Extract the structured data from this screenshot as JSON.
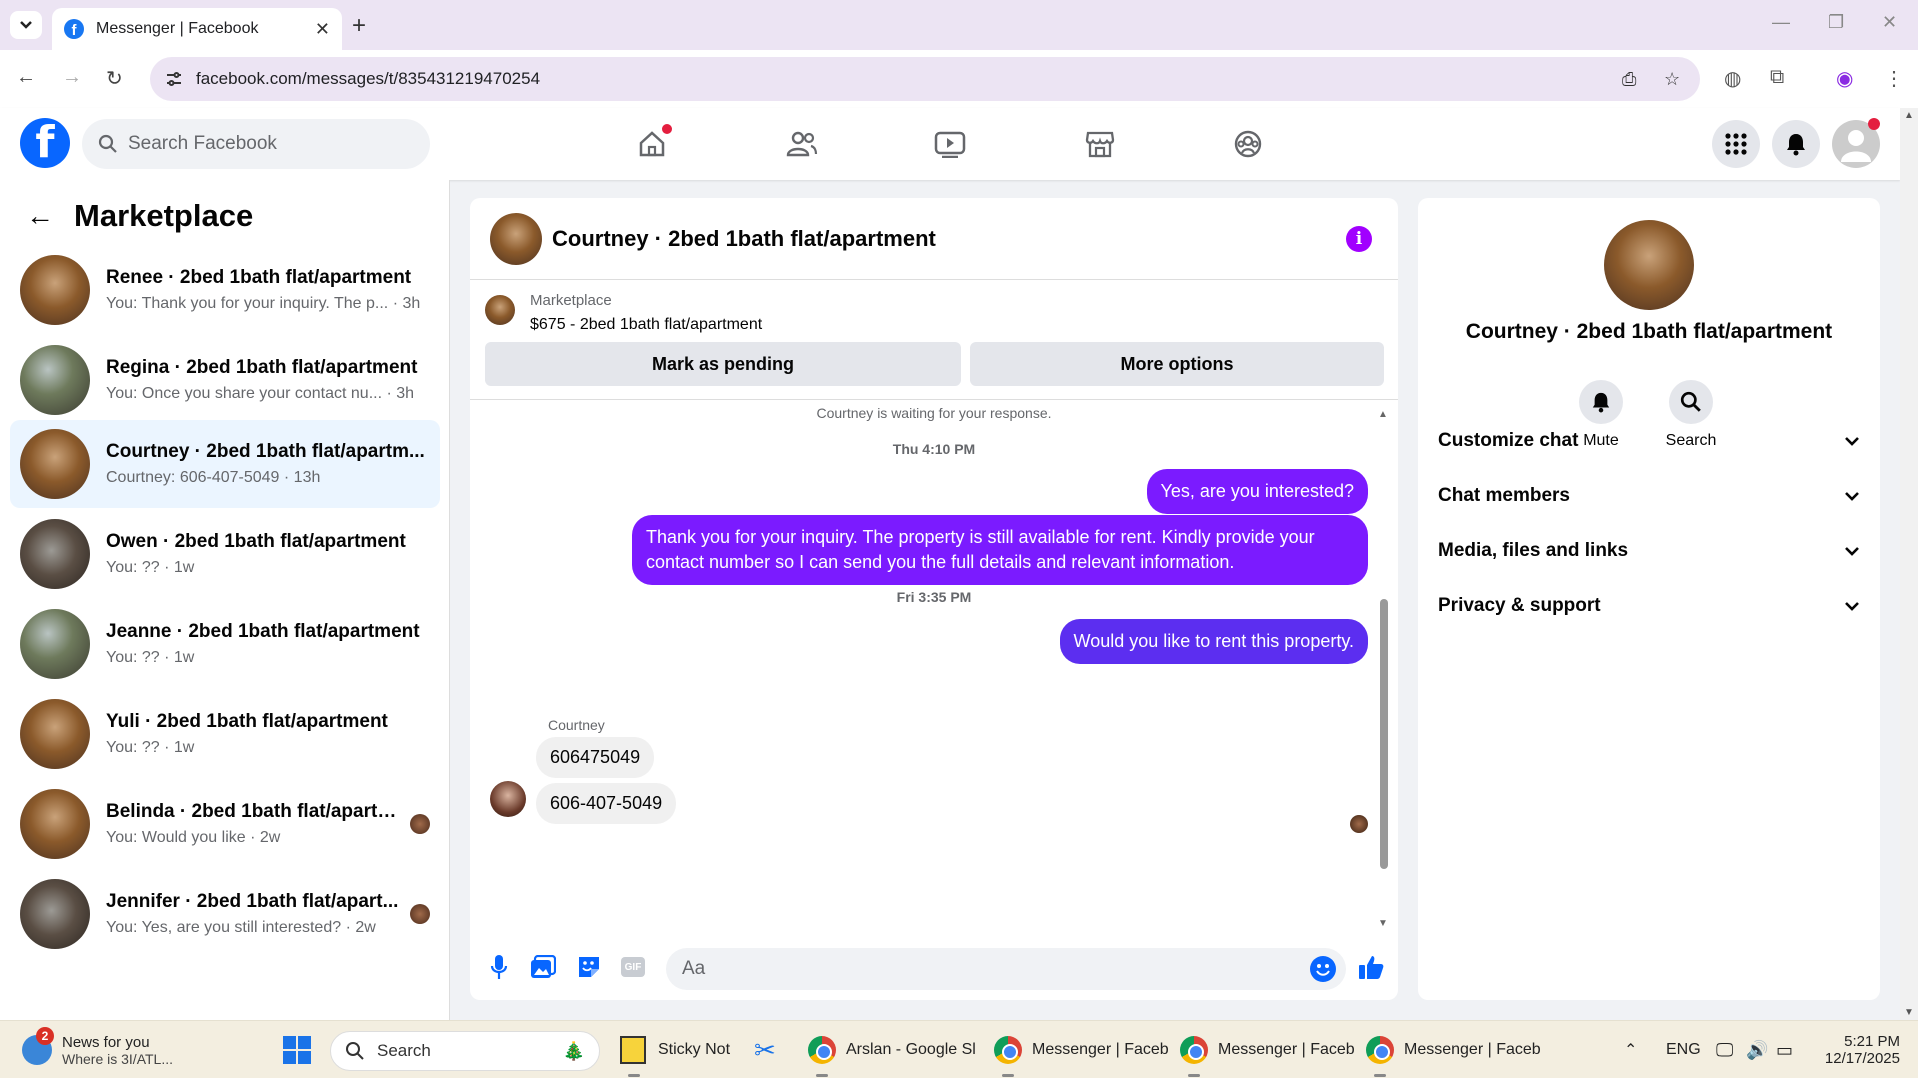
{
  "browser": {
    "tab_title": "Messenger | Facebook",
    "url": "facebook.com/messages/t/835431219470254"
  },
  "fb": {
    "search_placeholder": "Search Facebook"
  },
  "sidebar": {
    "title": "Marketplace",
    "conversations": [
      {
        "name": "Renee · 2bed 1bath flat/apartment",
        "preview": "You: Thank you for your inquiry. The p... · 3h",
        "avatar": "kitchen"
      },
      {
        "name": "Regina · 2bed 1bath flat/apartment",
        "preview": "You: Once you share your contact nu... · 3h",
        "avatar": "green"
      },
      {
        "name": "Courtney · 2bed 1bath flat/apartm...",
        "preview": "Courtney: 606-407-5049 · 13h",
        "avatar": "kitchen",
        "active": true
      },
      {
        "name": "Owen · 2bed 1bath flat/apartment",
        "preview": "You: ?? · 1w",
        "avatar": "dark"
      },
      {
        "name": "Jeanne · 2bed 1bath flat/apartment",
        "preview": "You: ?? · 1w",
        "avatar": "green"
      },
      {
        "name": "Yuli · 2bed 1bath flat/apartment",
        "preview": "You: ?? · 1w",
        "avatar": "kitchen"
      },
      {
        "name": "Belinda · 2bed 1bath flat/apartm...",
        "preview": "You: Would you like · 2w",
        "avatar": "kitchen"
      },
      {
        "name": "Jennifer · 2bed 1bath flat/apart...",
        "preview": "You: Yes, are you still interested? · 2w",
        "avatar": "dark"
      }
    ]
  },
  "chat": {
    "title": "Courtney · 2bed 1bath flat/apartment",
    "marketplace_label": "Marketplace",
    "listing": "$675 - 2bed 1bath flat/apartment",
    "mark_pending": "Mark as pending",
    "more_options": "More options",
    "waiting": "Courtney is waiting for your response.",
    "ts1": "Thu 4:10 PM",
    "msg1": "Yes, are you interested?",
    "msg2_line1": "Thank you for your inquiry. The property is still available for rent. Kindly provide your",
    "msg2_line2": "contact number so I can send you the full details and relevant information.",
    "ts2": "Fri 3:35 PM",
    "msg3": "Would you like to rent this property.",
    "sender": "Courtney",
    "reply1": "606475049",
    "reply2": "606-407-5049",
    "input_placeholder": "Aa"
  },
  "info_panel": {
    "name": "Courtney · 2bed 1bath flat/apartment",
    "mute": "Mute",
    "search": "Search",
    "rows": [
      "Customize chat",
      "Chat members",
      "Media, files and links",
      "Privacy & support"
    ]
  },
  "taskbar": {
    "news_title": "News for you",
    "news_sub": "Where is 3I/ATL...",
    "news_badge": "2",
    "search": "Search",
    "apps": [
      "Sticky Not",
      "Arslan - Google Sl",
      "Messenger | Faceb",
      "Messenger | Faceb",
      "Messenger | Faceb"
    ],
    "lang": "ENG",
    "time": "5:21 PM",
    "date": "12/17/2025"
  },
  "colors": {
    "fb_blue": "#0866ff",
    "bubble_purple": "#7b1bff",
    "bubble_blue": "#5c2ef0",
    "info_purple": "#a100ff"
  }
}
